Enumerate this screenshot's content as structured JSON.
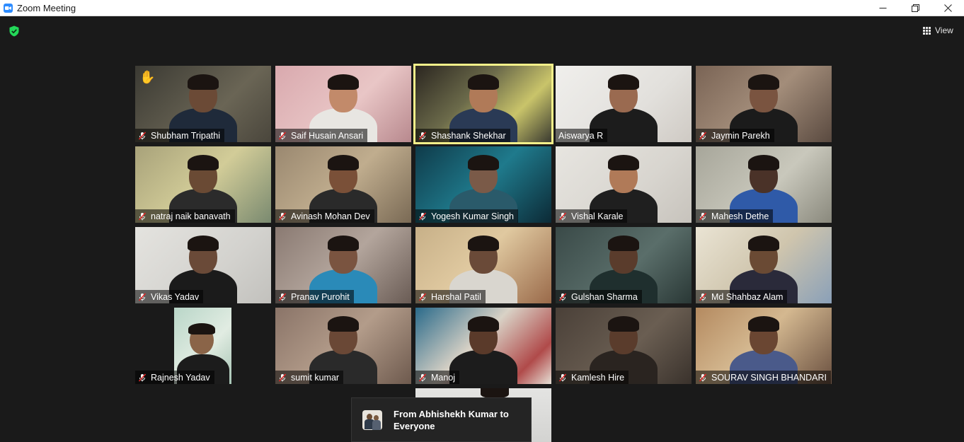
{
  "window": {
    "title": "Zoom Meeting"
  },
  "toolbar": {
    "view_label": "View"
  },
  "participants": [
    {
      "name": "Shubham Tripathi",
      "hand_raised": true
    },
    {
      "name": "Saif Husain Ansari"
    },
    {
      "name": "Shashank Shekhar",
      "active_speaker": true
    },
    {
      "name": "Aiswarya R",
      "muted": false
    },
    {
      "name": "Jaymin Parekh"
    },
    {
      "name": "natraj naik banavath"
    },
    {
      "name": "Avinash Mohan Dev"
    },
    {
      "name": "Yogesh Kumar Singh"
    },
    {
      "name": "Vishal Karale"
    },
    {
      "name": "Mahesh Dethe"
    },
    {
      "name": "Vikas Yadav"
    },
    {
      "name": "Pranav Purohit"
    },
    {
      "name": "Harshal Patil"
    },
    {
      "name": "Gulshan Sharma"
    },
    {
      "name": "Md Shahbaz Alam"
    },
    {
      "name": "Rajnesh Yadav"
    },
    {
      "name": "sumit kumar"
    },
    {
      "name": "Manoj"
    },
    {
      "name": "Kamlesh Hire"
    },
    {
      "name": "SOURAV SINGH BHANDARI"
    }
  ],
  "chat_notification": {
    "text": "From Abhishekh Kumar to Everyone"
  },
  "colors": {
    "background": "#1a1a1a",
    "active_speaker_border": "#f4f08a",
    "muted_mic": "#e02828",
    "security_shield": "#23d959"
  }
}
